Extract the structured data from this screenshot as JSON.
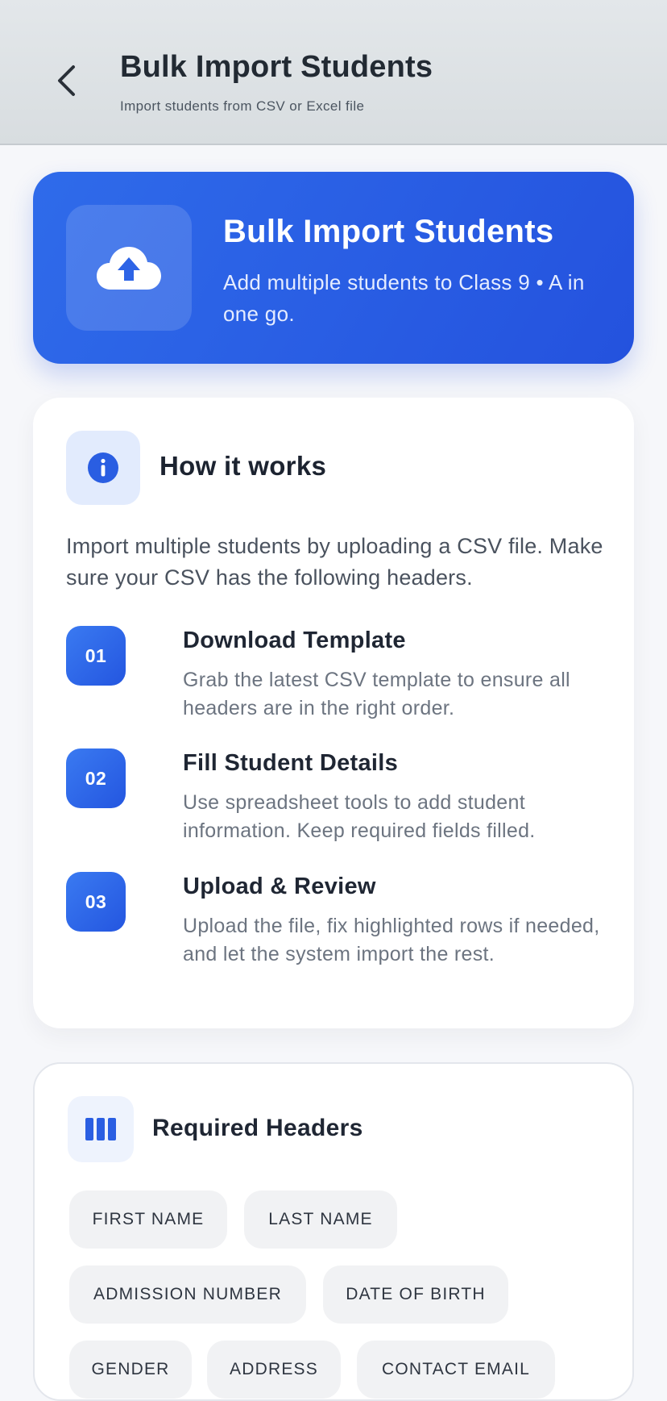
{
  "appbar": {
    "title": "Bulk Import Students",
    "subtitle": "Import students from CSV or Excel file",
    "back_icon": "chevron-left-icon"
  },
  "hero": {
    "title": "Bulk Import Students",
    "description": "Add multiple students to Class 9 • A in one go.",
    "icon": "cloud-upload-icon"
  },
  "how_it_works": {
    "title": "How it works",
    "icon": "info-icon",
    "intro": "Import multiple students by uploading a CSV file. Make sure your CSV has the following headers.",
    "steps": [
      {
        "number": "01",
        "title": "Download Template",
        "description": "Grab the latest CSV template to ensure all headers are in the right order."
      },
      {
        "number": "02",
        "title": "Fill Student Details",
        "description": "Use spreadsheet tools to add student information. Keep required fields filled."
      },
      {
        "number": "03",
        "title": "Upload & Review",
        "description": "Upload the file, fix highlighted rows if needed, and let the system import the rest."
      }
    ]
  },
  "required_headers": {
    "title": "Required Headers",
    "icon": "columns-icon",
    "chips": [
      "FIRST NAME",
      "LAST NAME",
      "ADMISSION NUMBER",
      "DATE OF BIRTH",
      "GENDER",
      "ADDRESS",
      "CONTACT EMAIL"
    ]
  },
  "colors": {
    "accent": "#2456e0",
    "hero_start": "#2f6bea",
    "chip_bg": "#f1f2f4"
  }
}
